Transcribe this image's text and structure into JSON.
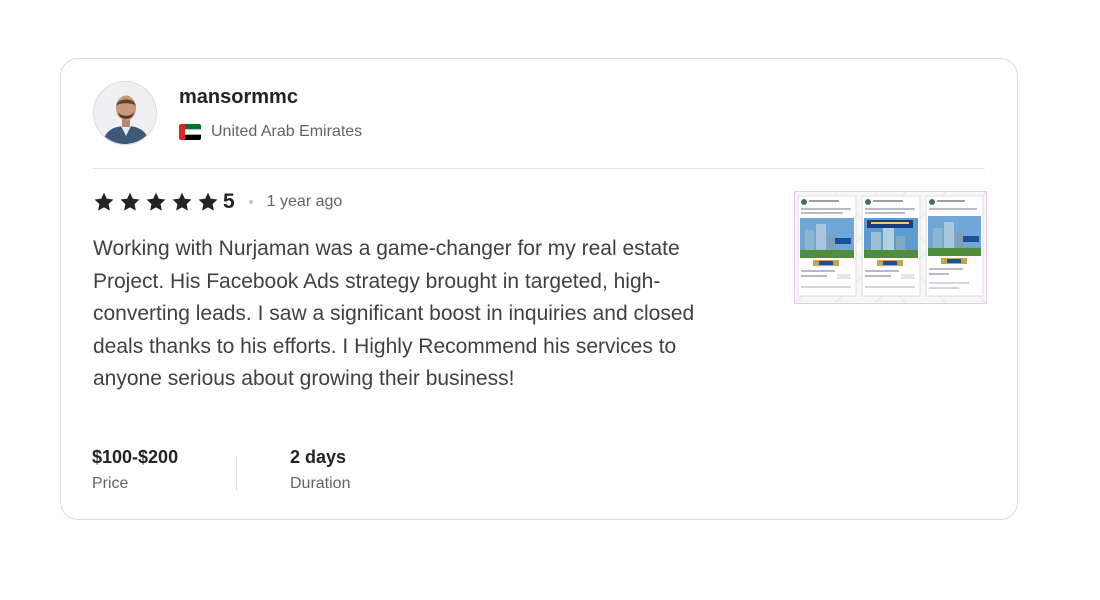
{
  "review": {
    "username": "mansormmc",
    "country": "United Arab Emirates",
    "rating": "5",
    "rating_fraction": 1.0,
    "time_ago": "1 year ago",
    "text": "Working with Nurjaman was a game-changer for my real estate Project. His Facebook Ads strategy brought in targeted, high-converting leads. I saw a significant boost in inquiries and closed deals thanks to his efforts. I Highly Recommend his services to anyone serious about growing their business!",
    "price_value": "$100-$200",
    "price_label": "Price",
    "duration_value": "2 days",
    "duration_label": "Duration"
  },
  "icons": {
    "star": "star-icon",
    "flag": "uae-flag-icon",
    "avatar": "user-avatar",
    "attachment": "attachment-thumbnail"
  },
  "colors": {
    "star": "#222325",
    "border": "#dadbdd",
    "text_primary": "#222325",
    "text_secondary": "#62646a"
  }
}
